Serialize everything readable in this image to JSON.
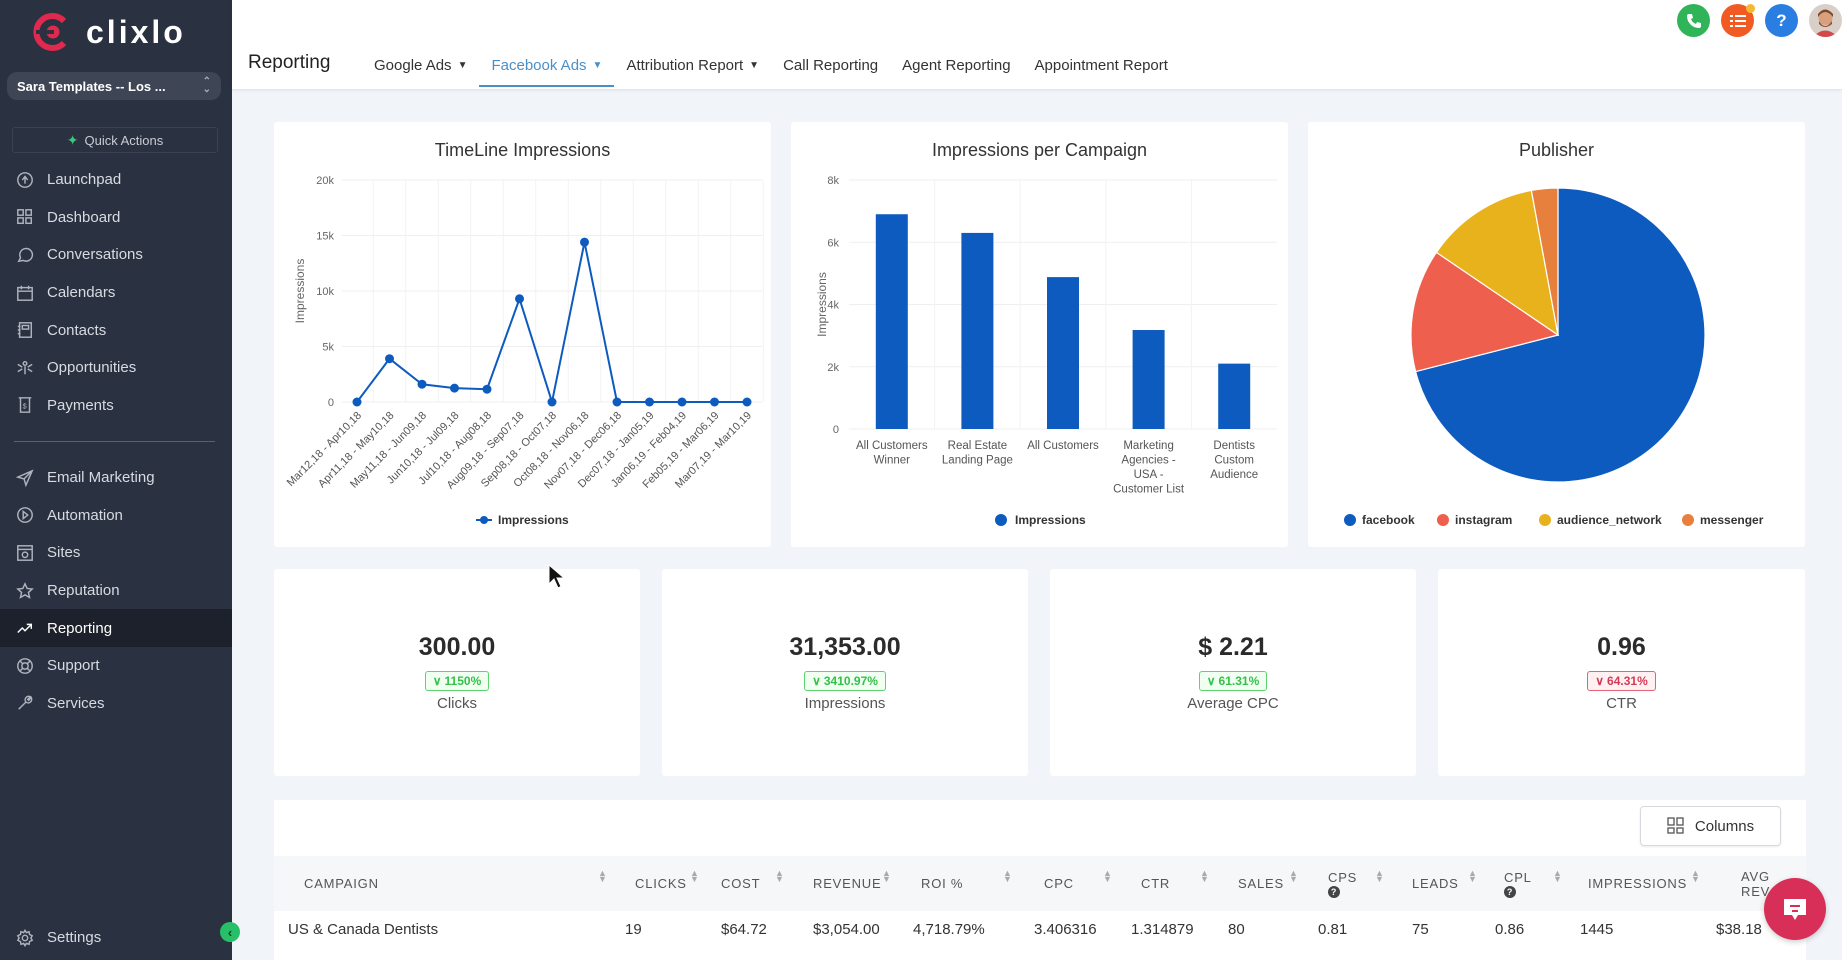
{
  "app": {
    "brand": "clixlo"
  },
  "sidebar": {
    "account": "Sara Templates -- Los ...",
    "quick_actions": "Quick Actions",
    "items_top": [
      {
        "label": "Launchpad",
        "icon": "rocket-icon"
      },
      {
        "label": "Dashboard",
        "icon": "dashboard-icon"
      },
      {
        "label": "Conversations",
        "icon": "chat-bubble-icon"
      },
      {
        "label": "Calendars",
        "icon": "calendar-icon"
      },
      {
        "label": "Contacts",
        "icon": "contacts-book-icon"
      },
      {
        "label": "Opportunities",
        "icon": "opportunities-icon"
      },
      {
        "label": "Payments",
        "icon": "payments-icon"
      }
    ],
    "items_bottom": [
      {
        "label": "Email Marketing",
        "icon": "send-icon"
      },
      {
        "label": "Automation",
        "icon": "play-circle-icon"
      },
      {
        "label": "Sites",
        "icon": "globe-window-icon"
      },
      {
        "label": "Reputation",
        "icon": "star-icon"
      },
      {
        "label": "Reporting",
        "icon": "trend-up-icon",
        "active": true
      },
      {
        "label": "Support",
        "icon": "lifebuoy-icon"
      },
      {
        "label": "Services",
        "icon": "wrench-icon"
      }
    ],
    "settings": "Settings"
  },
  "header": {
    "title": "Reporting",
    "tabs": [
      {
        "label": "Google Ads",
        "dropdown": true
      },
      {
        "label": "Facebook Ads",
        "dropdown": true,
        "active": true
      },
      {
        "label": "Attribution Report",
        "dropdown": true
      },
      {
        "label": "Call Reporting"
      },
      {
        "label": "Agent Reporting"
      },
      {
        "label": "Appointment Report"
      }
    ],
    "icons": [
      {
        "name": "phone-icon",
        "color": "#2fb457"
      },
      {
        "name": "task-list-icon",
        "color": "#f15a22"
      },
      {
        "name": "help-icon",
        "color": "#2a7de1"
      },
      {
        "name": "user-avatar",
        "color": "#c9a48a"
      }
    ]
  },
  "colors": {
    "series_blue": "#0d5bbf",
    "instagram": "#ef5f4d",
    "audience_network": "#e8b21d",
    "messenger": "#e8803d",
    "tab_active": "#4a90c8"
  },
  "chart_data": [
    {
      "type": "line",
      "title": "TimeLine Impressions",
      "xlabel": "",
      "ylabel": "Impressions",
      "ylim": [
        0,
        20000
      ],
      "yticks": [
        0,
        5000,
        10000,
        15000,
        20000
      ],
      "ytick_labels": [
        "0",
        "5k",
        "10k",
        "15k",
        "20k"
      ],
      "grid": true,
      "legend": "bottom",
      "categories": [
        "Mar12,18 - Apr10,18",
        "Apr11,18 - May10,18",
        "May11,18 - Jun09,18",
        "Jun10,18 - Jul09,18",
        "Jul10,18 - Aug08,18",
        "Aug09,18 - Sep07,18",
        "Sep08,18 - Oct07,18",
        "Oct08,18 - Nov06,18",
        "Nov07,18 - Dec06,18",
        "Dec07,18 - Jan05,19",
        "Jan06,19 - Feb04,19",
        "Feb05,19 - Mar06,19",
        "Mar07,19 - Mar10,19"
      ],
      "series": [
        {
          "name": "Impressions",
          "values": [
            0,
            3900,
            1600,
            1250,
            1150,
            9300,
            0,
            14400,
            0,
            0,
            0,
            0,
            0
          ]
        }
      ]
    },
    {
      "type": "bar",
      "title": "Impressions per Campaign",
      "xlabel": "",
      "ylabel": "Impressions",
      "ylim": [
        0,
        8000
      ],
      "yticks": [
        0,
        2000,
        4000,
        6000,
        8000
      ],
      "ytick_labels": [
        "0",
        "2k",
        "4k",
        "6k",
        "8k"
      ],
      "grid": true,
      "legend": "bottom",
      "categories": [
        [
          "All Customers",
          "Winner"
        ],
        [
          "Real Estate",
          "Landing Page"
        ],
        [
          "All Customers"
        ],
        [
          "Marketing",
          "Agencies -",
          "USA -",
          "Customer List"
        ],
        [
          "Dentists",
          "Custom",
          "Audience"
        ]
      ],
      "series": [
        {
          "name": "Impressions",
          "values": [
            6900,
            6300,
            4880,
            3180,
            2100
          ]
        }
      ]
    },
    {
      "type": "pie",
      "title": "Publisher",
      "legend": "bottom",
      "labels": [
        "facebook",
        "instagram",
        "audience_network",
        "messenger"
      ],
      "values": [
        71,
        13.5,
        12.6,
        2.9
      ]
    }
  ],
  "kpis": [
    {
      "value": "300.00",
      "change": "1150%",
      "trend": "good",
      "label": "Clicks"
    },
    {
      "value": "31,353.00",
      "change": "3410.97%",
      "trend": "good",
      "label": "Impressions"
    },
    {
      "value": "$ 2.21",
      "change": "61.31%",
      "trend": "good",
      "label": "Average CPC"
    },
    {
      "value": "0.96",
      "change": "64.31%",
      "trend": "bad",
      "label": "CTR"
    }
  ],
  "table": {
    "columns_button": "Columns",
    "headers": [
      "CAMPAIGN",
      "CLICKS",
      "COST",
      "REVENUE",
      "ROI %",
      "CPC",
      "CTR",
      "SALES",
      "CPS",
      "LEADS",
      "CPL",
      "IMPRESSIONS",
      "AVG REV."
    ],
    "header_lines": [
      [
        "CAMPAIGN"
      ],
      [
        "CLICKS"
      ],
      [
        "COST"
      ],
      [
        "REVENUE"
      ],
      [
        "ROI %"
      ],
      [
        "CPC"
      ],
      [
        "CTR"
      ],
      [
        "SALES"
      ],
      [
        "CPS",
        "?"
      ],
      [
        "LEADS"
      ],
      [
        "CPL",
        "?"
      ],
      [
        "IMPRESSIONS"
      ],
      [
        "AVG",
        "REV."
      ]
    ],
    "rows": [
      [
        "US & Canada Dentists",
        "19",
        "$64.72",
        "$3,054.00",
        "4,718.79%",
        "3.406316",
        "1.314879",
        "80",
        "0.81",
        "75",
        "0.86",
        "1445",
        "$38.18"
      ]
    ]
  }
}
